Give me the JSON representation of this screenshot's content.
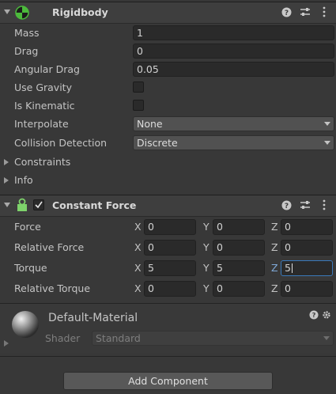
{
  "rigidbody": {
    "title": "Rigidbody",
    "fields": {
      "mass_label": "Mass",
      "mass_value": "1",
      "drag_label": "Drag",
      "drag_value": "0",
      "angular_drag_label": "Angular Drag",
      "angular_drag_value": "0.05",
      "use_gravity_label": "Use Gravity",
      "use_gravity_checked": false,
      "is_kinematic_label": "Is Kinematic",
      "is_kinematic_checked": false,
      "interpolate_label": "Interpolate",
      "interpolate_value": "None",
      "collision_detection_label": "Collision Detection",
      "collision_detection_value": "Discrete"
    },
    "foldouts": {
      "constraints": "Constraints",
      "info": "Info"
    }
  },
  "constant_force": {
    "title": "Constant Force",
    "enabled": true,
    "rows": [
      {
        "label": "Force",
        "x": "0",
        "y": "0",
        "z": "0"
      },
      {
        "label": "Relative Force",
        "x": "0",
        "y": "0",
        "z": "0"
      },
      {
        "label": "Torque",
        "x": "5",
        "y": "5",
        "z": "5"
      },
      {
        "label": "Relative Torque",
        "x": "0",
        "y": "0",
        "z": "0"
      }
    ],
    "axis_labels": {
      "x": "X",
      "y": "Y",
      "z": "Z"
    }
  },
  "material": {
    "name": "Default-Material",
    "shader_label": "Shader",
    "shader_value": "Standard"
  },
  "add_component_label": "Add Component",
  "colors": {
    "background": "#383838",
    "header": "#3e3e3e",
    "field": "#2a2a2a",
    "active_border": "#3a79bb",
    "rigidbody_icon_green": "#4cba3c",
    "constant_force_icon_green": "#7ed36b"
  }
}
